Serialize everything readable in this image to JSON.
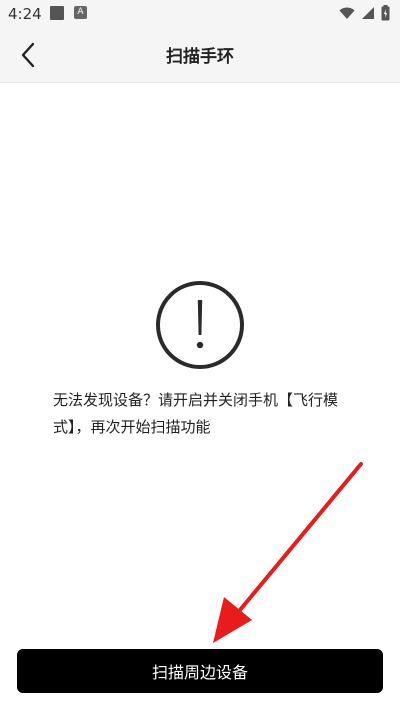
{
  "status_bar": {
    "time": "4:24",
    "notification_icons": [
      "square-icon",
      "a-badge-icon"
    ],
    "system_icons": [
      "wifi-icon",
      "signal-icon",
      "battery-icon"
    ],
    "a_badge": "A"
  },
  "header": {
    "title": "扫描手环",
    "back_icon": "chevron-left-icon"
  },
  "main": {
    "icon": "alert-circle-icon",
    "message": "无法发现设备？请开启并关闭手机【飞行模式】，再次开始扫描功能"
  },
  "footer": {
    "scan_button_label": "扫描周边设备"
  },
  "colors": {
    "background": "#ffffff",
    "header_bg": "#f5f5f5",
    "button_bg": "#000000",
    "button_text": "#ffffff",
    "annotation_arrow": "#e81c1c"
  }
}
